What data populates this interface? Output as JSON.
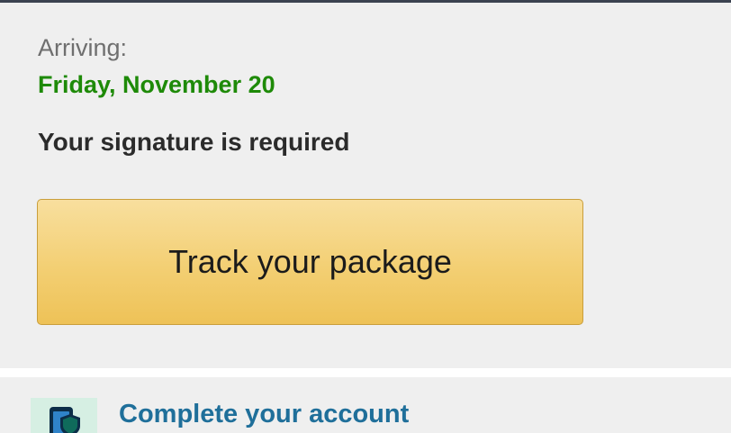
{
  "delivery": {
    "arriving_label": "Arriving:",
    "arrival_date": "Friday, November 20",
    "signature_note": "Your signature is required",
    "track_button_label": "Track your package"
  },
  "account": {
    "icon": "phone-shield-icon",
    "link_label": "Complete your account"
  },
  "colors": {
    "top_bar": "#3b4250",
    "card_background": "#efefef",
    "arrival_date": "#1e8a08",
    "button_top": "#f8df9e",
    "button_bottom": "#eec257",
    "link": "#1f6f9a",
    "icon_tile": "#d6efe3"
  }
}
